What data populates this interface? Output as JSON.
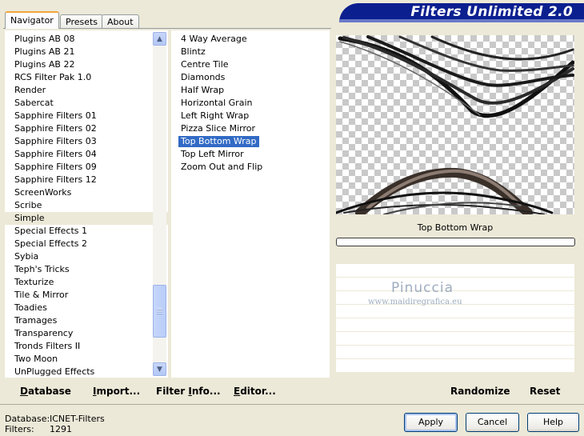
{
  "tabs": [
    "Navigator",
    "Presets",
    "About"
  ],
  "title": "Filters Unlimited 2.0",
  "categories": [
    "Plugins AB 08",
    "Plugins AB 21",
    "Plugins AB 22",
    "RCS Filter Pak 1.0",
    "Render",
    "Sabercat",
    "Sapphire Filters 01",
    "Sapphire Filters 02",
    "Sapphire Filters 03",
    "Sapphire Filters 04",
    "Sapphire Filters 09",
    "Sapphire Filters 12",
    "ScreenWorks",
    "Scribe",
    "Simple",
    "Special Effects 1",
    "Special Effects 2",
    "Sybia",
    "Teph's Tricks",
    "Texturize",
    "Tile & Mirror",
    "Toadies",
    "Tramages",
    "Transparency",
    "Tronds Filters II",
    "Two Moon",
    "UnPlugged Effects"
  ],
  "selected_category": "Simple",
  "filters": [
    "4 Way Average",
    "Blintz",
    "Centre Tile",
    "Diamonds",
    "Half Wrap",
    "Horizontal Grain",
    "Left Right Wrap",
    "Pizza Slice Mirror",
    "Top Bottom Wrap",
    "Top Left Mirror",
    "Zoom Out and Flip"
  ],
  "selected_filter": "Top Bottom Wrap",
  "preview": {
    "label": "Top Bottom Wrap",
    "progress": 0
  },
  "watermark": {
    "name": "Pinuccia",
    "url": "www.maidiregrafica.eu"
  },
  "actions": {
    "database": "Database",
    "import": "Import...",
    "filter_info": "Filter Info...",
    "editor": "Editor...",
    "randomize": "Randomize",
    "reset": "Reset"
  },
  "status": {
    "database_label": "Database:",
    "database_value": "ICNET-Filters",
    "filters_label": "Filters:",
    "filters_value": "1291"
  },
  "buttons": {
    "apply": "Apply",
    "cancel": "Cancel",
    "help": "Help"
  },
  "colors": {
    "banner": "#0b1f8f",
    "selection": "#316ac5",
    "tab_highlight": "#f1a63e"
  }
}
